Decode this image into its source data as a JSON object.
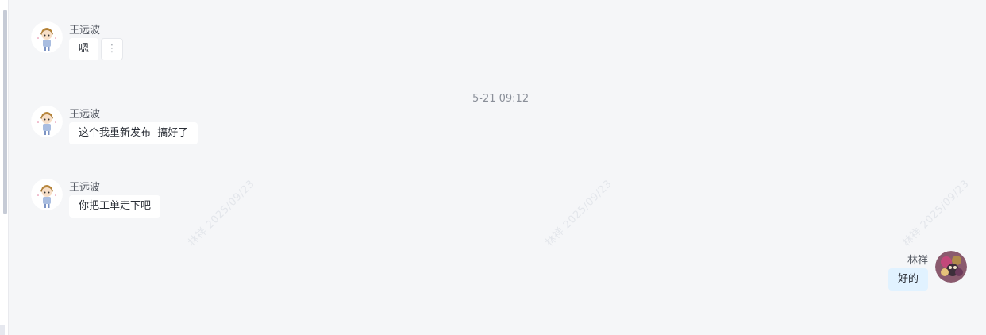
{
  "messages": [
    {
      "sender": "王远波",
      "text": "嗯",
      "side": "left",
      "avatar": "boy-cartoon-avatar"
    },
    {
      "sender": "王远波",
      "text": "这个我重新发布  搞好了",
      "side": "left",
      "avatar": "boy-cartoon-avatar"
    },
    {
      "sender": "王远波",
      "text": "你把工单走下吧",
      "side": "left",
      "avatar": "boy-cartoon-avatar"
    },
    {
      "sender": "林祥",
      "text": "好的",
      "side": "right",
      "avatar": "illustration-avatar"
    }
  ],
  "timestamp": "5-21 09:12",
  "more_icon": "⋮",
  "watermark": "林祥 2025/09/23",
  "colors": {
    "background": "#f5f6f8",
    "bubble_other": "#ffffff",
    "bubble_mine": "#e1f2ff",
    "scrollbar": "#c6cbd6"
  }
}
